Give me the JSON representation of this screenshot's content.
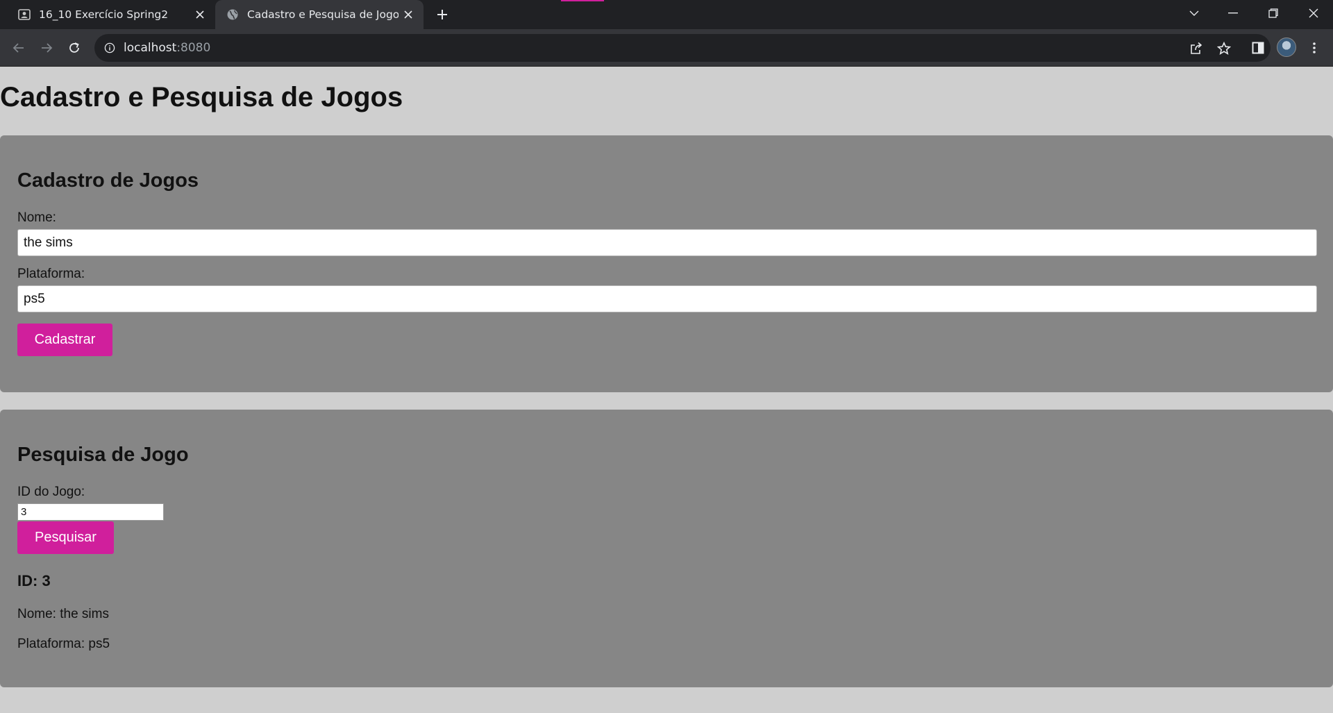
{
  "browser": {
    "tabs": [
      {
        "title": "16_10 Exercício Spring2",
        "icon": "person-card-icon"
      },
      {
        "title": "Cadastro e Pesquisa de Jogos",
        "icon": "globe-icon"
      }
    ],
    "url": {
      "host": "localhost",
      "port": ":8080"
    },
    "accent_color": "#d01f9c"
  },
  "page": {
    "title": "Cadastro e Pesquisa de Jogos",
    "cadastro": {
      "heading": "Cadastro de Jogos",
      "nome_label": "Nome:",
      "nome_value": "the sims",
      "plataforma_label": "Plataforma:",
      "plataforma_value": "ps5",
      "submit_label": "Cadastrar"
    },
    "pesquisa": {
      "heading": "Pesquisa de Jogo",
      "id_label": "ID do Jogo:",
      "id_value": "3",
      "submit_label": "Pesquisar",
      "result": {
        "id": "ID: 3",
        "nome": "Nome: the sims",
        "plataforma": "Plataforma: ps5"
      }
    },
    "button_color": "#d01f9c",
    "panel_color": "#868686",
    "background_color": "#cfcfcf"
  }
}
